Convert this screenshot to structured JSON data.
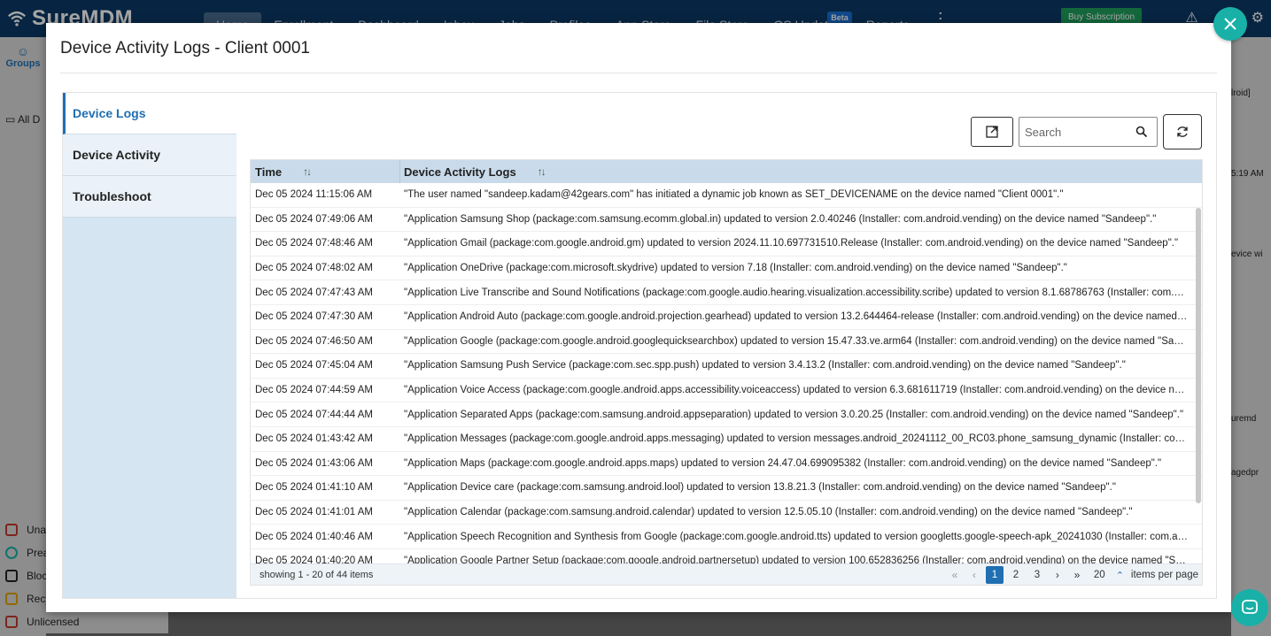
{
  "app": {
    "brand": "SureMDM",
    "nav": [
      "Home",
      "Enrollment",
      "Dashboard",
      "Inbox",
      "Jobs",
      "Profiles",
      "App Store",
      "File Store",
      "OS Updates",
      "Reports"
    ],
    "nav_badge": "Beta",
    "buy_label": "Buy Subscription",
    "side_label": "Groups",
    "side_tree_label": "All D",
    "bottom_items": [
      "Una",
      "Prea",
      "Bloc",
      "Recy",
      "Unlicensed"
    ],
    "right_snippets": [
      "lroid]",
      "5:19 AM",
      "evice wi",
      "uremd",
      "agedpr"
    ]
  },
  "modal": {
    "title": "Device Activity Logs - Client 0001",
    "tabs": [
      "Device Logs",
      "Device Activity",
      "Troubleshoot"
    ],
    "search_placeholder": "Search",
    "columns": {
      "time": "Time",
      "logs": "Device Activity Logs"
    },
    "rows": [
      {
        "time": "Dec 05 2024 11:15:06 AM",
        "log": "\"The user named \"sandeep.kadam@42gears.com\" has initiated a dynamic job known as SET_DEVICENAME on the device named \"Client 0001\".\""
      },
      {
        "time": "Dec 05 2024 07:49:06 AM",
        "log": "\"Application Samsung Shop (package:com.samsung.ecomm.global.in) updated to version 2.0.40246 (Installer: com.android.vending) on the device named \"Sandeep\".\""
      },
      {
        "time": "Dec 05 2024 07:48:46 AM",
        "log": "\"Application Gmail (package:com.google.android.gm) updated to version 2024.11.10.697731510.Release (Installer: com.android.vending) on the device named \"Sandeep\".\""
      },
      {
        "time": "Dec 05 2024 07:48:02 AM",
        "log": "\"Application OneDrive (package:com.microsoft.skydrive) updated to version 7.18 (Installer: com.android.vending) on the device named \"Sandeep\".\""
      },
      {
        "time": "Dec 05 2024 07:47:43 AM",
        "log": "\"Application Live Transcribe and Sound Notifications (package:com.google.audio.hearing.visualization.accessibility.scribe) updated to version 8.1.68786763 (Installer: com.android.vending)\""
      },
      {
        "time": "Dec 05 2024 07:47:30 AM",
        "log": "\"Application Android Auto (package:com.google.android.projection.gearhead) updated to version 13.2.644464-release (Installer: com.android.vending) on the device named \"Sandeep\".\""
      },
      {
        "time": "Dec 05 2024 07:46:50 AM",
        "log": "\"Application Google (package:com.google.android.googlequicksearchbox) updated to version 15.47.33.ve.arm64 (Installer: com.android.vending) on the device named \"Sandeep\".\""
      },
      {
        "time": "Dec 05 2024 07:45:04 AM",
        "log": "\"Application Samsung Push Service (package:com.sec.spp.push) updated to version 3.4.13.2 (Installer: com.android.vending) on the device named \"Sandeep\".\""
      },
      {
        "time": "Dec 05 2024 07:44:59 AM",
        "log": "\"Application Voice Access (package:com.google.android.apps.accessibility.voiceaccess) updated to version 6.3.681611719 (Installer: com.android.vending) on the device named \"Sandeep\".\""
      },
      {
        "time": "Dec 05 2024 07:44:44 AM",
        "log": "\"Application Separated Apps (package:com.samsung.android.appseparation) updated to version 3.0.20.25 (Installer: com.android.vending) on the device named \"Sandeep\".\""
      },
      {
        "time": "Dec 05 2024 01:43:42 AM",
        "log": "\"Application Messages (package:com.google.android.apps.messaging) updated to version messages.android_20241112_00_RC03.phone_samsung_dynamic (Installer: com.android.vending)\""
      },
      {
        "time": "Dec 05 2024 01:43:06 AM",
        "log": "\"Application Maps (package:com.google.android.apps.maps) updated to version 24.47.04.699095382 (Installer: com.android.vending) on the device named \"Sandeep\".\""
      },
      {
        "time": "Dec 05 2024 01:41:10 AM",
        "log": "\"Application Device care (package:com.samsung.android.lool) updated to version 13.8.21.3 (Installer: com.android.vending) on the device named \"Sandeep\".\""
      },
      {
        "time": "Dec 05 2024 01:41:01 AM",
        "log": "\"Application Calendar (package:com.samsung.android.calendar) updated to version 12.5.05.10 (Installer: com.android.vending) on the device named \"Sandeep\".\""
      },
      {
        "time": "Dec 05 2024 01:40:46 AM",
        "log": "\"Application Speech Recognition and Synthesis from Google (package:com.google.android.tts) updated to version googletts.google-speech-apk_20241030 (Installer: com.android.vending)\""
      },
      {
        "time": "Dec 05 2024 01:40:20 AM",
        "log": "\"Application Google Partner Setup (package:com.google.android.partnersetup) updated to version 100.652836256 (Installer: com.android.vending) on the device named \"Sandeep\".\""
      }
    ],
    "footer_info": "showing 1 - 20 of 44 items",
    "pages": [
      "1",
      "2",
      "3"
    ],
    "current_page": "1",
    "page_size": "20",
    "page_size_label": "items per page"
  },
  "colors": {
    "accent": "#1f6fb2",
    "close": "#19b0a8",
    "header_bg": "#c9dbea",
    "topbar": "#0b3a66"
  }
}
